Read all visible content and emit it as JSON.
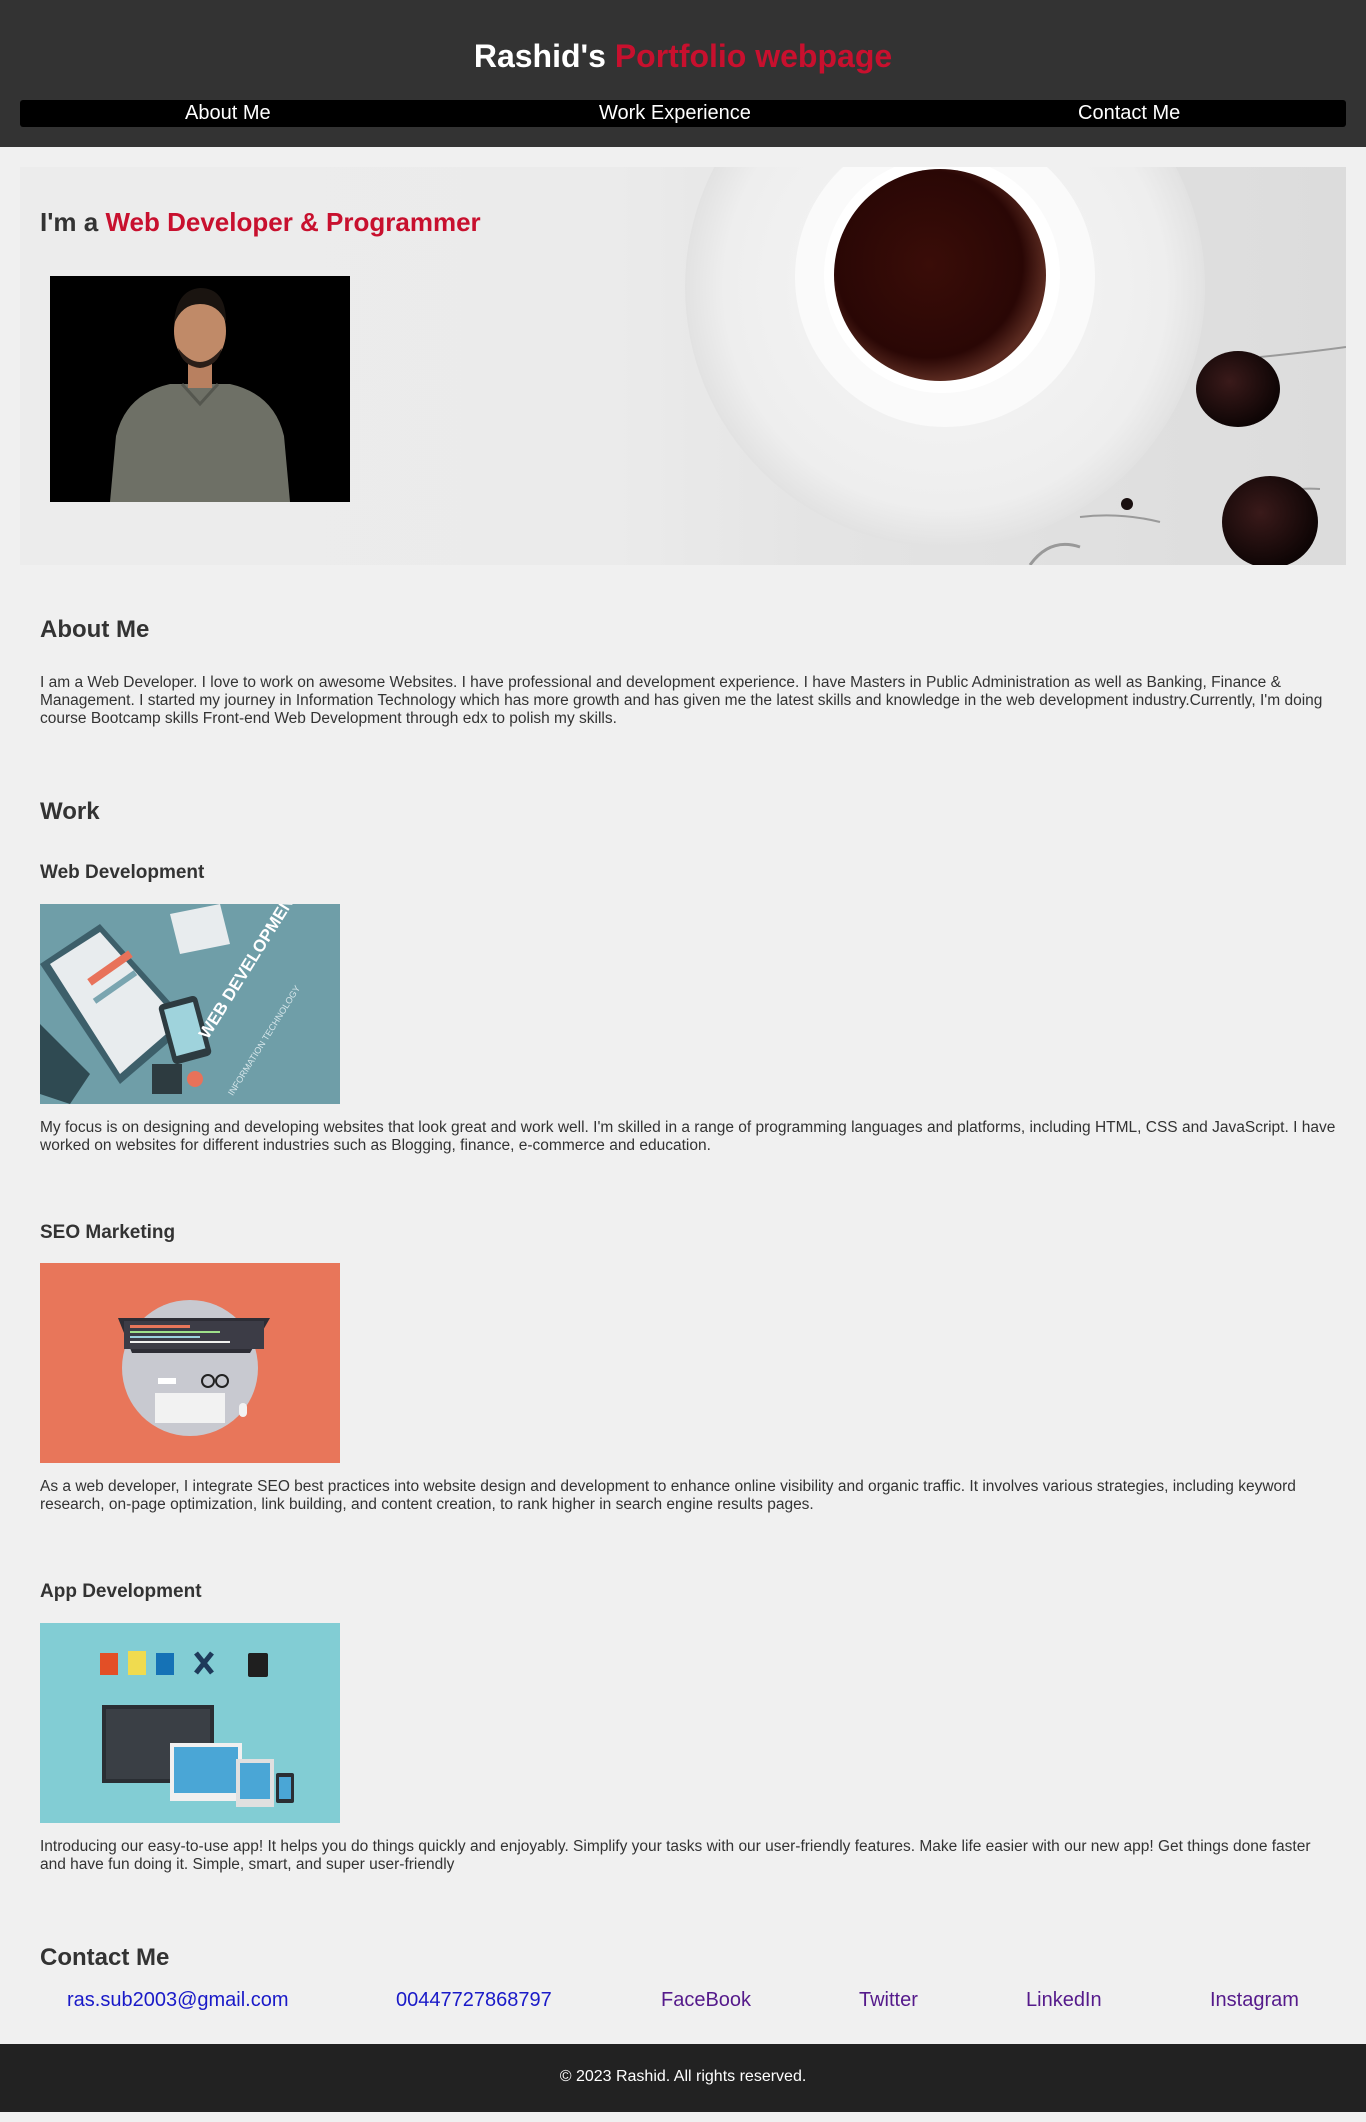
{
  "header": {
    "title_main": "Rashid's",
    "title_accent": "Portfolio webpage",
    "nav": [
      {
        "label": "About Me"
      },
      {
        "label": "Work Experience"
      },
      {
        "label": "Contact Me"
      }
    ]
  },
  "hero": {
    "prefix": "I'm a",
    "accent": "Web Developer & Programmer"
  },
  "about": {
    "heading": "About Me",
    "text": "I am a Web Developer. I love to work on awesome Websites. I have professional and development experience. I have Masters in Public Administration as well as Banking, Finance & Management. I started my journey in Information Technology which has more growth and has given me the latest skills and knowledge in the web development industry.Currently, I'm doing course Bootcamp skills Front-end Web Development through edx to polish my skills."
  },
  "work": {
    "heading": "Work",
    "items": [
      {
        "title": "Web Development",
        "image_text": "WEB DEVELOPMENT",
        "image_subtext": "INFORMATION TECHNOLOGY",
        "text": "My focus is on designing and developing websites that look great and work well. I'm skilled in a range of programming languages and platforms, including HTML, CSS and JavaScript. I have worked on websites for different industries such as Blogging, finance, e-commerce and education."
      },
      {
        "title": "SEO Marketing",
        "text": "As a web developer, I integrate SEO best practices into website design and development to enhance online visibility and organic traffic. It involves various strategies, including keyword research, on-page optimization, link building, and content creation, to rank higher in search engine results pages."
      },
      {
        "title": "App Development",
        "text": "Introducing our easy-to-use app! It helps you do things quickly and enjoyably. Simplify your tasks with our user-friendly features. Make life easier with our new app! Get things done faster and have fun doing it. Simple, smart, and super user-friendly"
      }
    ]
  },
  "contact": {
    "heading": "Contact Me",
    "email": "ras.sub2003@gmail.com",
    "phone": "00447727868797",
    "facebook": "FaceBook",
    "twitter": "Twitter",
    "linkedin": "LinkedIn",
    "instagram": "Instagram"
  },
  "footer": {
    "text": "© 2023 Rashid. All rights reserved."
  },
  "colors": {
    "accent": "#c8102e",
    "header_bg": "#333333",
    "nav_bg": "#000000",
    "page_bg": "#f0f0f0",
    "footer_bg": "#222222",
    "link_unvisited": "#1a1ac8",
    "link_visited": "#551a8b"
  }
}
